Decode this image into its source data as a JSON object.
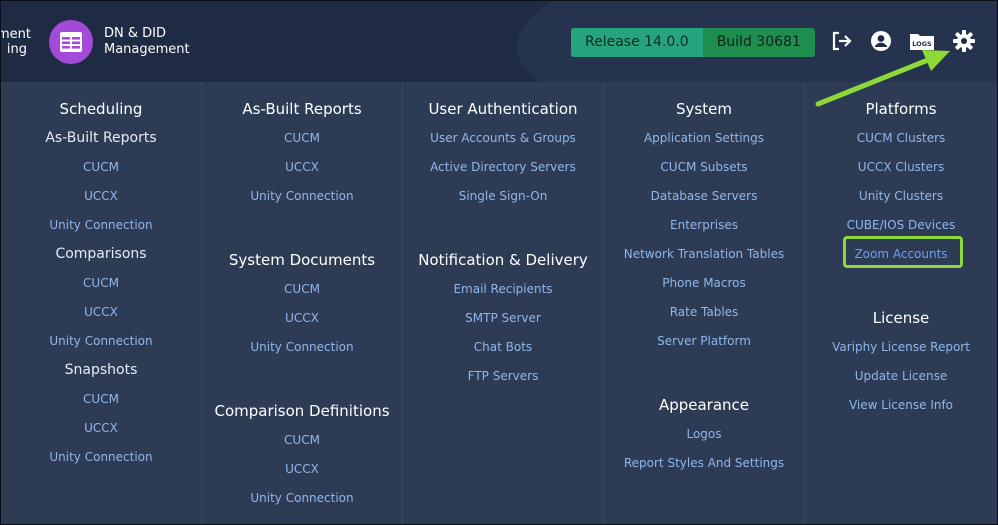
{
  "header": {
    "left_text_1": "ment",
    "left_text_2": "ing",
    "app_title_1": "DN & DID",
    "app_title_2": "Management",
    "release": "Release 14.0.0",
    "build": "Build 30681",
    "logs_label": "LOGS",
    "icons": [
      "logout-icon",
      "user-icon",
      "logs-folder-icon",
      "gear-icon"
    ]
  },
  "menu": {
    "col1": {
      "heading": "Scheduling",
      "sub1": "As-Built Reports",
      "sub1_items": [
        "CUCM",
        "UCCX",
        "Unity Connection"
      ],
      "sub2": "Comparisons",
      "sub2_items": [
        "CUCM",
        "UCCX",
        "Unity Connection"
      ],
      "sub3": "Snapshots",
      "sub3_items": [
        "CUCM",
        "UCCX",
        "Unity Connection"
      ]
    },
    "col2": {
      "heading1": "As-Built Reports",
      "items1": [
        "CUCM",
        "UCCX",
        "Unity Connection"
      ],
      "heading2": "System Documents",
      "items2": [
        "CUCM",
        "UCCX",
        "Unity Connection"
      ],
      "heading3": "Comparison Definitions",
      "items3": [
        "CUCM",
        "UCCX",
        "Unity Connection"
      ]
    },
    "col3": {
      "heading1": "User Authentication",
      "items1": [
        "User Accounts & Groups",
        "Active Directory Servers",
        "Single Sign-On"
      ],
      "heading2": "Notification & Delivery",
      "items2": [
        "Email Recipients",
        "SMTP Server",
        "Chat Bots",
        "FTP Servers"
      ]
    },
    "col4": {
      "heading1": "System",
      "items1": [
        "Application Settings",
        "CUCM Subsets",
        "Database Servers",
        "Enterprises",
        "Network Translation Tables",
        "Phone Macros",
        "Rate Tables",
        "Server Platform"
      ],
      "heading2": "Appearance",
      "items2": [
        "Logos",
        "Report Styles And Settings"
      ]
    },
    "col5": {
      "heading1": "Platforms",
      "items1": [
        "CUCM Clusters",
        "UCCX Clusters",
        "Unity Clusters",
        "CUBE/IOS Devices",
        "Zoom Accounts"
      ],
      "heading2": "License",
      "items2": [
        "Variphy License Report",
        "Update License",
        "View License Info"
      ]
    }
  },
  "colors": {
    "header_bg": "#1f2a44",
    "menu_bg": "#2e3b55",
    "link": "#8fb7ea",
    "release_bg": "#26a47e",
    "build_bg": "#1e8e4f",
    "annotation": "#8ed83a"
  }
}
